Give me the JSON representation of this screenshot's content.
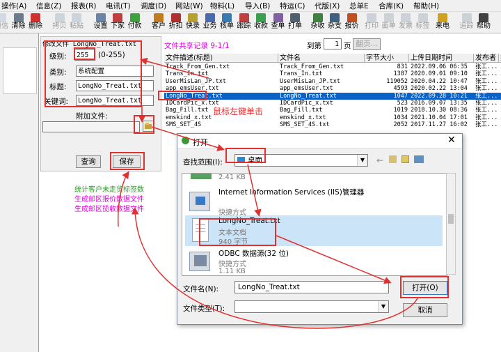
{
  "menu": [
    "操作(A)",
    "信息(Z)",
    "报表(R)",
    "电讯(T)",
    "调度(D)",
    "网站(W)",
    "物料(L)",
    "导入(B)",
    "特运(C)",
    "代版(X)",
    "总单E",
    "合库(K)",
    "帮助(H)"
  ],
  "toolbar": [
    {
      "label": "短信",
      "icon": "sms-icon",
      "color": "#9ab0c8",
      "disabled": true
    },
    {
      "label": "清除",
      "icon": "clear-icon",
      "color": "#6c7c8c",
      "disabled": false
    },
    {
      "label": "删除",
      "icon": "delete-icon",
      "color": "#d03030",
      "disabled": false
    },
    {
      "label": "拷贝",
      "icon": "copy-icon",
      "color": "#8aa0b8",
      "disabled": true
    },
    {
      "label": "粘贴",
      "icon": "paste-icon",
      "color": "#8aa0b8",
      "disabled": true
    },
    {
      "label": "设置",
      "icon": "settings-icon",
      "color": "#6a84a6",
      "disabled": false
    },
    {
      "label": "下家",
      "icon": "downstream-icon",
      "color": "#c04040",
      "disabled": false
    },
    {
      "label": "付款",
      "icon": "payment-icon",
      "color": "#40a040",
      "disabled": false
    },
    {
      "label": "客户",
      "icon": "customer-icon",
      "color": "#c07a20",
      "disabled": false
    },
    {
      "label": "折扣",
      "icon": "discount-icon",
      "color": "#b03030",
      "disabled": false
    },
    {
      "label": "快录",
      "icon": "quick-entry-icon",
      "color": "#b8a030",
      "disabled": false
    },
    {
      "label": "业务",
      "icon": "business-icon",
      "color": "#4a6ab0",
      "disabled": false
    },
    {
      "label": "核单",
      "icon": "verify-icon",
      "color": "#3a7ab0",
      "disabled": false
    },
    {
      "label": "跟踪",
      "icon": "tracking-icon",
      "color": "#c04040",
      "disabled": false
    },
    {
      "label": "收款",
      "icon": "receive-icon",
      "color": "#3aa050",
      "disabled": false
    },
    {
      "label": "查单",
      "icon": "search-order-icon",
      "color": "#8060a0",
      "disabled": false
    },
    {
      "label": "打单",
      "icon": "print-order-icon",
      "color": "#506070",
      "disabled": false
    },
    {
      "label": "杂收",
      "icon": "misc-receive-icon",
      "color": "#408040",
      "disabled": false
    },
    {
      "label": "杂支",
      "icon": "misc-pay-icon",
      "color": "#406080",
      "disabled": false
    },
    {
      "label": "报价",
      "icon": "quote-icon",
      "color": "#c05020",
      "disabled": false
    },
    {
      "label": "打印",
      "icon": "print-icon",
      "color": "#8a9aaa",
      "disabled": true
    },
    {
      "label": "面单",
      "icon": "waybill-icon",
      "color": "#8a9aaa",
      "disabled": true
    },
    {
      "label": "发票",
      "icon": "invoice-icon",
      "color": "#8a9aaa",
      "disabled": true
    },
    {
      "label": "标签",
      "icon": "label-icon",
      "color": "#8a9aaa",
      "disabled": true
    },
    {
      "label": "来电",
      "icon": "phone-icon",
      "color": "#d0a020",
      "disabled": false
    },
    {
      "label": "追踪",
      "icon": "trace-icon",
      "color": "#8a9aaa",
      "disabled": true
    },
    {
      "label": "帮助",
      "icon": "help-icon",
      "color": "#404040",
      "disabled": false
    }
  ],
  "form": {
    "header": "修改文件 LongNo_Treat.txt",
    "level_label": "级别:",
    "level_value": "255",
    "level_hint": "(0-255)",
    "category_label": "类别:",
    "category_value": "系统配置",
    "title_label": "标题:",
    "title_value": "LongNo_Treat.txt",
    "keyword_label": "关键词:",
    "keyword_value": "LongNo_Treat.txt",
    "attach_label": "附加文件:",
    "query_button": "查询",
    "save_button": "保存"
  },
  "stats": {
    "line1": "统计客户未走货标签数",
    "line2": "生成邮区报价数据文件",
    "line3": "生成邮区揽收数据文件"
  },
  "table": {
    "caption": "文件共享记录 9-1/1",
    "page_label": "到第",
    "page_value": "1",
    "page_unit": "页",
    "page_button": "翻页...",
    "columns": [
      "文件描述(标题)",
      "文件名",
      "字节大小",
      "上传日期时间",
      "发布者",
      "类"
    ],
    "rows": [
      [
        "Track_From_Gen.txt",
        "Track_From_Gen.txt",
        "831",
        "2022.09.06 06:35",
        "张工....",
        "系"
      ],
      [
        "Trans_In.txt",
        "Trans_In.txt",
        "1387",
        "2020.09.01 09:10",
        "张工....",
        "系"
      ],
      [
        "UserMisLan_JP.txt",
        "UserMisLan_JP.txt",
        "119052",
        "2020.04.22 10:47",
        "张工....",
        "系"
      ],
      [
        "app_emsUser.txt",
        "app_emsUser.txt",
        "4593",
        "2020.02.22 13:04",
        "张工....",
        "系"
      ],
      [
        "LongNo_Treat.txt",
        "LongNo_Treat.txt",
        "1047",
        "2022.09.28 10:21",
        "张工....",
        "系"
      ],
      [
        "IDCardPic_x.txt",
        "IDCardPic_x.txt",
        "523",
        "2016.09.07 13:35",
        "张工....",
        "系"
      ],
      [
        "Bag_Fill.txt",
        "Bag_Fill.txt",
        "1019",
        "2018.10.30 08:36",
        "张工....",
        "系"
      ],
      [
        "emskind_x.txt",
        "emskind_x.txt",
        "1034",
        "2021.10.04 17:01",
        "张工....",
        "系"
      ],
      [
        "SMS_SET_4S",
        "SMS_SET_4S.txt",
        "2052",
        "2017.11.27 16:02",
        "张工....",
        "系"
      ]
    ],
    "selected_row": 4
  },
  "annotation_click": "鼠标左键单击",
  "dialog": {
    "title": "打开",
    "lookin_label": "查找范围(I):",
    "lookin_value": "桌面",
    "items": [
      {
        "name": "",
        "sub": "2.41 KB",
        "icon": "drive-icon"
      },
      {
        "name": "Internet Information Services (IIS)管理器",
        "sub": "快捷方式",
        "icon": "iis-shortcut-icon"
      },
      {
        "name": "LongNo_Treat.txt",
        "sub": "文本文档",
        "sub2": "940 字节",
        "icon": "text-file-icon"
      },
      {
        "name": "ODBC 数据源(32 位)",
        "sub": "快捷方式",
        "sub2": "1.11 KB",
        "icon": "odbc-shortcut-icon"
      }
    ],
    "filename_label": "文件名(N):",
    "filename_value": "LongNo_Treat.txt",
    "filetype_label": "文件类型(T):",
    "filetype_value": "",
    "open_button": "打开(O)",
    "cancel_button": "取消"
  }
}
